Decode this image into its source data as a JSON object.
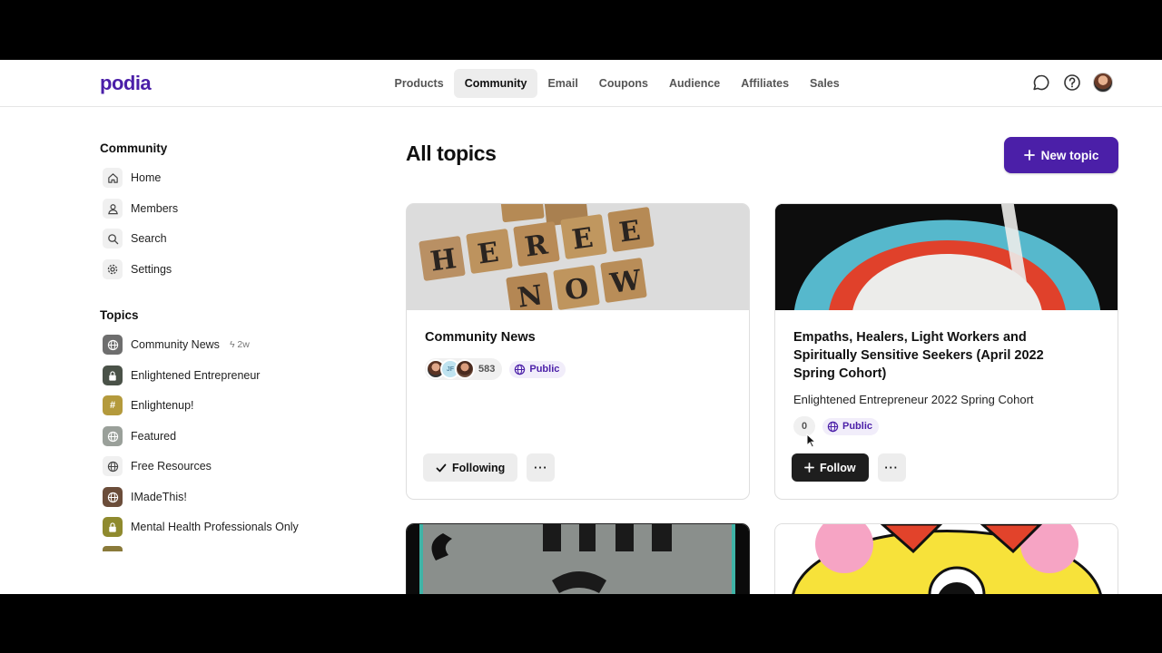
{
  "brand": {
    "name": "podia",
    "color": "#4b1fa8"
  },
  "nav": {
    "items": [
      {
        "label": "Products"
      },
      {
        "label": "Community",
        "active": true
      },
      {
        "label": "Email"
      },
      {
        "label": "Coupons"
      },
      {
        "label": "Audience"
      },
      {
        "label": "Affiliates"
      },
      {
        "label": "Sales"
      }
    ],
    "icons": [
      "chat-bubble-icon",
      "help-circle-icon",
      "user-avatar"
    ]
  },
  "sidebar": {
    "community_heading": "Community",
    "community_items": [
      {
        "label": "Home",
        "icon": "home-icon"
      },
      {
        "label": "Members",
        "icon": "user-icon"
      },
      {
        "label": "Search",
        "icon": "search-icon"
      },
      {
        "label": "Settings",
        "icon": "gear-icon"
      }
    ],
    "topics_heading": "Topics",
    "topics": [
      {
        "label": "Community News",
        "meta": "2w",
        "icon": "globe-icon",
        "color": "#6e6e6e"
      },
      {
        "label": "Enlightened Entrepreneur",
        "icon": "lock-icon",
        "color": "#4a5248"
      },
      {
        "label": "Enlightenup!",
        "icon": "hash-icon",
        "color": "#b49a3c"
      },
      {
        "label": "Featured",
        "icon": "globe-icon",
        "color": "#9aa09a"
      },
      {
        "label": "Free Resources",
        "icon": "globe-icon",
        "color": "#f0f0f0"
      },
      {
        "label": "IMadeThis!",
        "icon": "globe-icon",
        "color": "#6b4d3a"
      },
      {
        "label": "Mental Health Professionals Only",
        "icon": "lock-icon",
        "color": "#8f8a2e"
      }
    ]
  },
  "main": {
    "title": "All topics",
    "new_topic_label": "New topic",
    "cards": [
      {
        "title": "Community News",
        "member_count": "583",
        "visibility": "Public",
        "primary_action": "Following",
        "image": "scrabble-be-here-now"
      },
      {
        "title": "Empaths, Healers, Light Workers and Spiritually Sensitive Seekers (April 2022 Spring Cohort)",
        "subtitle": "Enlightened Entrepreneur 2022 Spring Cohort",
        "member_count": "0",
        "visibility": "Public",
        "primary_action": "Follow",
        "image": "rainbow-arch"
      }
    ]
  }
}
